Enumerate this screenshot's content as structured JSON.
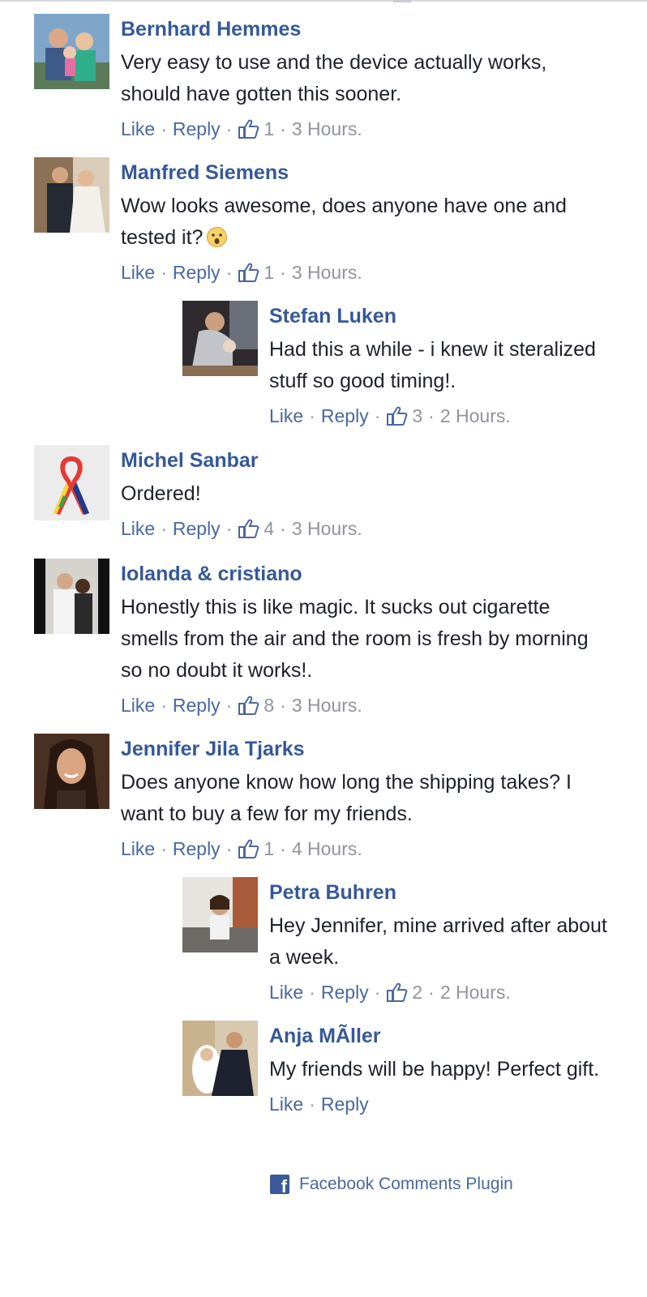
{
  "comments": [
    {
      "author": "Bernhard Hemmes",
      "text": "Very easy to use and the device actually works, should have gotten this sooner.",
      "like_label": "Like",
      "reply_label": "Reply",
      "likes": "1",
      "time": "3 Hours."
    },
    {
      "author": "Manfred Siemens",
      "text": "Wow looks awesome, does anyone have one and tested it?",
      "emoji": "surprised-face-emoji",
      "like_label": "Like",
      "reply_label": "Reply",
      "likes": "1",
      "time": "3 Hours."
    },
    {
      "author": "Stefan Luken",
      "text": "Had this a while - i knew it steralized stuff so good timing!.",
      "like_label": "Like",
      "reply_label": "Reply",
      "likes": "3",
      "time": "2 Hours.",
      "is_reply": true
    },
    {
      "author": "Michel Sanbar",
      "text": "Ordered!",
      "like_label": "Like",
      "reply_label": "Reply",
      "likes": "4",
      "time": "3 Hours."
    },
    {
      "author": "Iolanda & cristiano",
      "text": "Honestly this is like magic. It sucks out cigarette smells from the air and the room is fresh by morning so no doubt it works!.",
      "like_label": "Like",
      "reply_label": "Reply",
      "likes": "8",
      "time": "3 Hours."
    },
    {
      "author": "Jennifer Jila Tjarks",
      "text": "Does anyone know how long the shipping takes? I want to buy a few for my friends.",
      "like_label": "Like",
      "reply_label": "Reply",
      "likes": "1",
      "time": "4 Hours."
    },
    {
      "author": "Petra Buhren",
      "text": "Hey Jennifer, mine arrived after about a week.",
      "like_label": "Like",
      "reply_label": "Reply",
      "likes": "2",
      "time": "2 Hours.",
      "is_reply": true
    },
    {
      "author": "Anja MÃller",
      "text": "My friends will be happy! Perfect gift.",
      "like_label": "Like",
      "reply_label": "Reply",
      "is_reply": true
    }
  ],
  "footer": {
    "plugin_label": "Facebook Comments Plugin",
    "icon": "facebook-icon"
  },
  "colors": {
    "author": "#365899",
    "link": "#4b67a1",
    "meta": "#90949c",
    "text": "#1d2129",
    "brand": "#3b5998"
  }
}
